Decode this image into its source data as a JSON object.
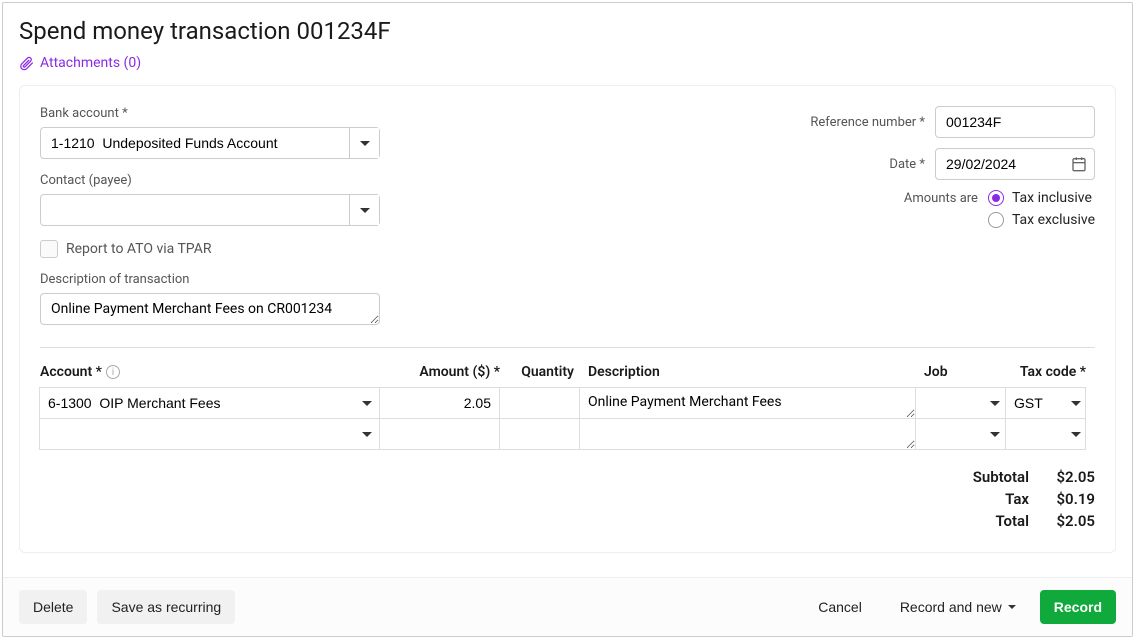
{
  "page_title": "Spend money transaction 001234F",
  "attachments": {
    "label": "Attachments (0)"
  },
  "fields": {
    "bank_account": {
      "label": "Bank account",
      "value": "1-1210  Undeposited Funds Account"
    },
    "contact": {
      "label": "Contact (payee)",
      "value": ""
    },
    "tpar": {
      "label": "Report to ATO via TPAR"
    },
    "description": {
      "label": "Description of transaction",
      "value": "Online Payment Merchant Fees on CR001234"
    },
    "reference": {
      "label": "Reference number",
      "value": "001234F"
    },
    "date": {
      "label": "Date",
      "value": "29/02/2024"
    },
    "amounts_are": {
      "label": "Amounts are",
      "options": {
        "inclusive": "Tax inclusive",
        "exclusive": "Tax exclusive"
      },
      "selected": "inclusive"
    }
  },
  "table": {
    "headers": {
      "account": "Account *",
      "amount": "Amount ($) *",
      "quantity": "Quantity",
      "description": "Description",
      "job": "Job",
      "tax_code": "Tax code *"
    },
    "rows": [
      {
        "account": "6-1300  OIP Merchant Fees",
        "amount": "2.05",
        "quantity": "",
        "description": "Online Payment Merchant Fees",
        "job": "",
        "tax_code": "GST"
      },
      {
        "account": "",
        "amount": "",
        "quantity": "",
        "description": "",
        "job": "",
        "tax_code": ""
      }
    ]
  },
  "totals": {
    "subtotal": {
      "label": "Subtotal",
      "value": "$2.05"
    },
    "tax": {
      "label": "Tax",
      "value": "$0.19"
    },
    "total": {
      "label": "Total",
      "value": "$2.05"
    }
  },
  "footer": {
    "delete": "Delete",
    "save_recurring": "Save as recurring",
    "cancel": "Cancel",
    "record_new": "Record and new",
    "record": "Record"
  }
}
